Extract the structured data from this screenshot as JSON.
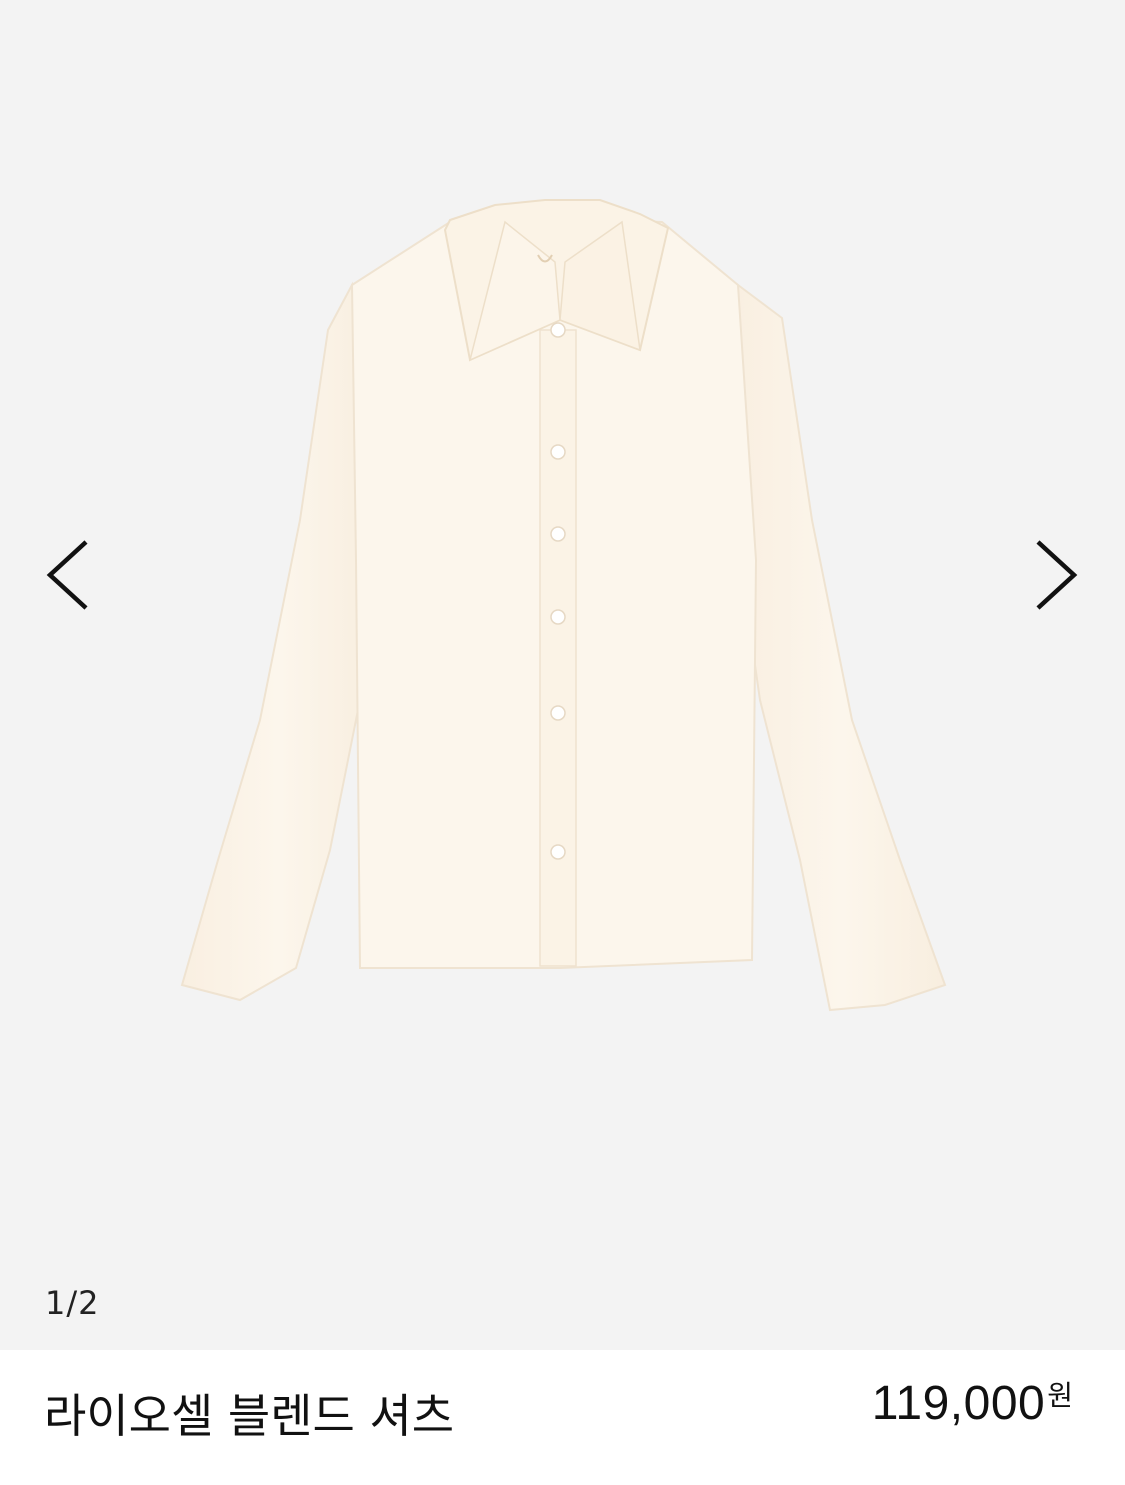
{
  "gallery": {
    "counter": "1/2",
    "prev_icon": "chevron-left-icon",
    "next_icon": "chevron-right-icon",
    "image": "shirt-photo"
  },
  "product": {
    "name": "라이오셀 블렌드 셔츠",
    "price": "119,000",
    "currency": "원"
  },
  "colors": {
    "gallery_bg": "#f3f3f3",
    "shirt": "#fbf4e9",
    "text": "#111111"
  }
}
